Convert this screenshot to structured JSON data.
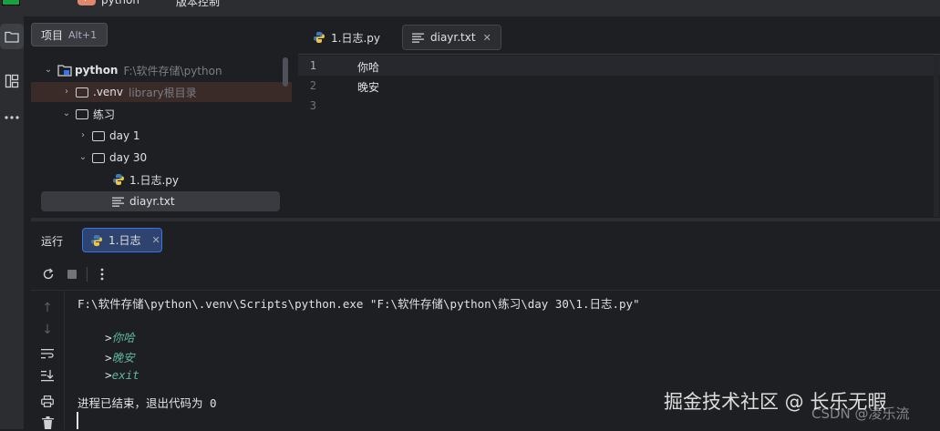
{
  "titlebar": {
    "project_chip": "P",
    "project_name": "python",
    "vcs_label": "版本控制"
  },
  "tooltip": {
    "label": "项目",
    "shortcut": "Alt+1"
  },
  "project_tree": {
    "root": {
      "name": "python",
      "path": "F:\\软件存储\\python"
    },
    "venv": {
      "name": ".venv",
      "hint": "library根目录"
    },
    "practice": {
      "name": "练习"
    },
    "day1": {
      "name": "day 1"
    },
    "day30": {
      "name": "day 30"
    },
    "file_py": {
      "name": "1.日志.py"
    },
    "file_txt": {
      "name": "diayr.txt"
    }
  },
  "editor": {
    "tabs": [
      {
        "label": "1.日志.py"
      },
      {
        "label": "diayr.txt"
      }
    ],
    "lines": [
      {
        "num": "1",
        "text": "你哈"
      },
      {
        "num": "2",
        "text": "晚安"
      },
      {
        "num": "3",
        "text": ""
      }
    ]
  },
  "run": {
    "label": "运行",
    "tab_label": "1.日志",
    "command": "F:\\软件存储\\python\\.venv\\Scripts\\python.exe \"F:\\软件存储\\python\\练习\\day 30\\1.日志.py\"",
    "prompt": ">",
    "inputs": [
      "你哈",
      "晚安",
      "exit"
    ],
    "exit_message": "进程已结束，退出代码为 0"
  },
  "watermark": {
    "main": "掘金技术社区 @ 长乐无暇",
    "sub": "CSDN @凌乐流"
  }
}
